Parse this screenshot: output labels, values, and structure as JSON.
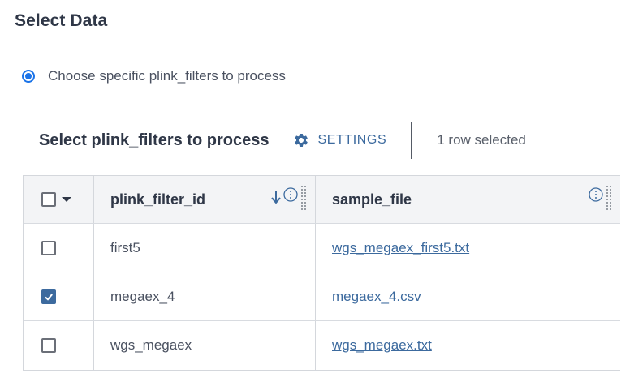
{
  "page": {
    "title": "Select Data"
  },
  "option": {
    "label": "Choose specific plink_filters to process",
    "selected": true
  },
  "toolbar": {
    "title": "Select plink_filters to process",
    "settings_label": "SETTINGS",
    "selection_status": "1 row selected"
  },
  "table": {
    "columns": [
      {
        "label": "plink_filter_id",
        "sort": "descending"
      },
      {
        "label": "sample_file"
      }
    ],
    "rows": [
      {
        "plink_filter_id": "first5",
        "sample_file": "wgs_megaex_first5.txt",
        "checked": false
      },
      {
        "plink_filter_id": "megaex_4",
        "sample_file": "megaex_4.csv",
        "checked": true
      },
      {
        "plink_filter_id": "wgs_megaex",
        "sample_file": "wgs_megaex.txt",
        "checked": false
      }
    ]
  },
  "colors": {
    "accent": "#3c6a9e",
    "radio": "#1a73e8",
    "header_bg": "#f3f4f6"
  }
}
